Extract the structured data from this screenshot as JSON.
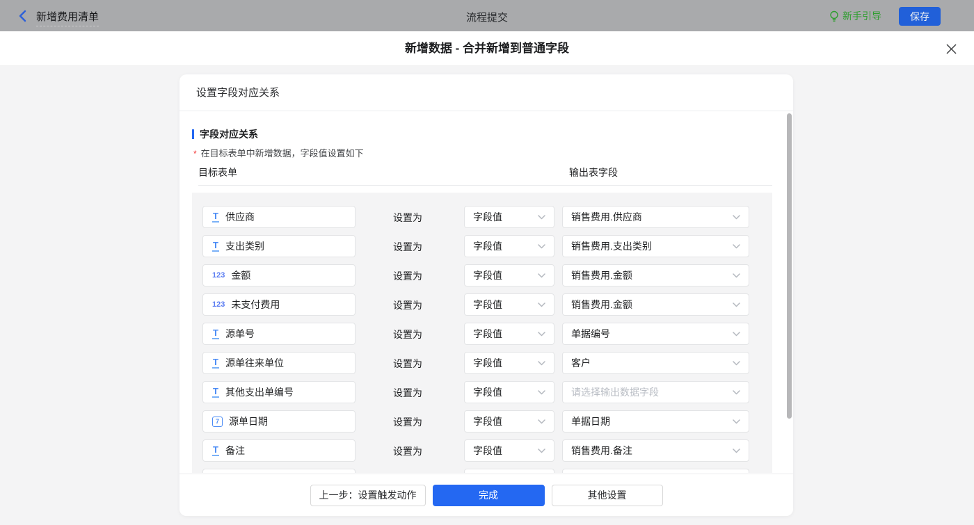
{
  "colors": {
    "accent_blue": "#2468f2",
    "topbar_bg": "#a9aaac",
    "save_button_blue": "#2160d9",
    "guide_green": "#2f9e2f",
    "required_red": "#f23030",
    "page_bg": "#f4f4f5"
  },
  "topbar": {
    "back_title": "新增费用清单",
    "center_title": "流程提交",
    "guide_label": "新手引导",
    "save_label": "保存"
  },
  "dialog": {
    "title": "新增数据 - 合并新增到普通字段"
  },
  "card": {
    "header": "设置字段对应关系",
    "section_title": "字段对应关系",
    "required_mark": "*",
    "note": "在目标表单中新增数据，字段值设置如下",
    "columns": {
      "target": "目标表单",
      "output": "输出表字段"
    },
    "set_as": "设置为",
    "has_partial_tenth_row": true
  },
  "rows": [
    {
      "icon": "text-field-icon",
      "field": "供应商",
      "value_type": "字段值",
      "output": "销售费用.供应商",
      "is_placeholder": false
    },
    {
      "icon": "text-field-icon",
      "field": "支出类别",
      "value_type": "字段值",
      "output": "销售费用.支出类别",
      "is_placeholder": false
    },
    {
      "icon": "number-field-icon",
      "field": "金额",
      "value_type": "字段值",
      "output": "销售费用.金额",
      "is_placeholder": false
    },
    {
      "icon": "number-field-icon",
      "field": "未支付费用",
      "value_type": "字段值",
      "output": "销售费用.金额",
      "is_placeholder": false
    },
    {
      "icon": "text-field-icon",
      "field": "源单号",
      "value_type": "字段值",
      "output": "单据编号",
      "is_placeholder": false
    },
    {
      "icon": "text-field-icon",
      "field": "源单往来单位",
      "value_type": "字段值",
      "output": "客户",
      "is_placeholder": false
    },
    {
      "icon": "text-field-icon",
      "field": "其他支出单编号",
      "value_type": "字段值",
      "output": "请选择输出数据字段",
      "is_placeholder": true
    },
    {
      "icon": "date-field-icon",
      "field": "源单日期",
      "value_type": "字段值",
      "output": "单据日期",
      "is_placeholder": false
    },
    {
      "icon": "text-field-icon",
      "field": "备注",
      "value_type": "字段值",
      "output": "销售费用.备注",
      "is_placeholder": false
    }
  ],
  "footer": {
    "back_button": "上一步：设置触发动作",
    "done_button": "完成",
    "other_button": "其他设置"
  }
}
